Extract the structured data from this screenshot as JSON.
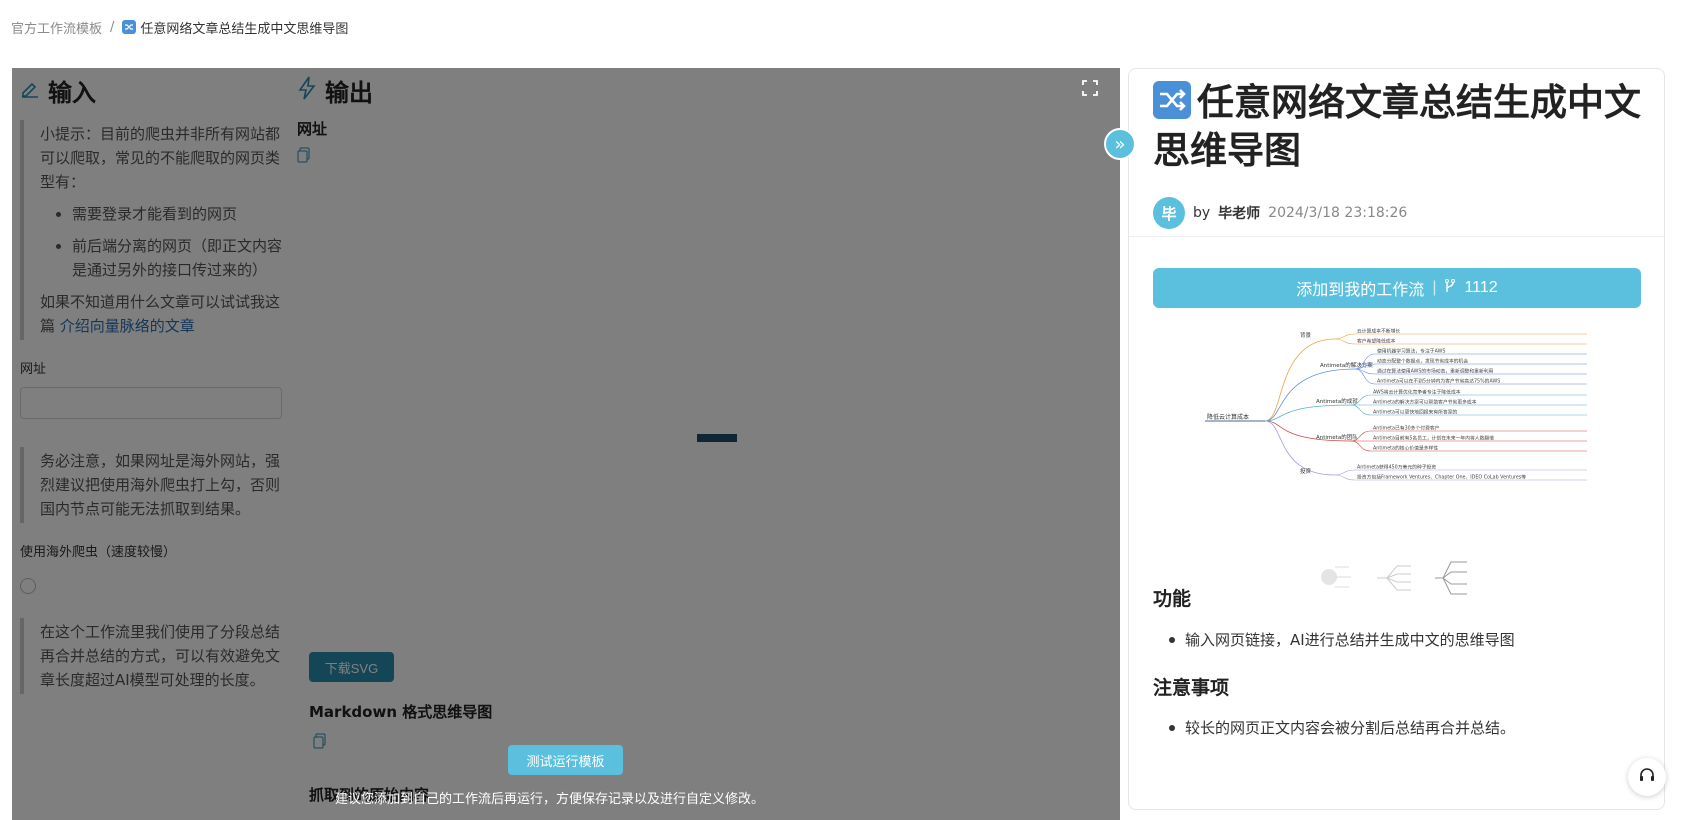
{
  "breadcrumb": {
    "parent": "官方工作流模板",
    "separator": "/",
    "current": "任意网络文章总结生成中文思维导图"
  },
  "input_section": {
    "title": "输入",
    "tip_intro": "小提示：目前的爬虫并非所有网站都可以爬取，常见的不能爬取的网页类型有：",
    "tip_items": [
      "需要登录才能看到的网页",
      "前后端分离的网页（即正文内容是通过另外的接口传过来的）"
    ],
    "tip_outro": "如果不知道用什么文章可以试试我这篇 ",
    "tip_link": "介绍向量脉络的文章",
    "url_label": "网址",
    "url_value": "",
    "warning": "务必注意，如果网址是海外网站，强烈建议把使用海外爬虫打上勾，否则国内节点可能无法抓取到结果。",
    "overseas_label": "使用海外爬虫（速度较慢）",
    "overseas_checked": false,
    "note": "在这个工作流里我们使用了分段总结再合并总结的方式，可以有效避免文章长度超过AI模型可处理的长度。"
  },
  "output_section": {
    "title": "输出",
    "url_label": "网址",
    "download_label": "下载SVG",
    "markdown_label": "Markdown 格式思维导图",
    "crawl_label": "抓取到的原始内容"
  },
  "actions": {
    "test_run": "测试运行模板",
    "hint": "建议您添加到自己的工作流后再运行，方便保存记录以及进行自定义修改。"
  },
  "panel": {
    "title": "任意网络文章总结生成中文思维导图",
    "avatar_char": "毕",
    "by": "by",
    "author": "毕老师",
    "date": "2024/3/18 23:18:26",
    "add_button": "添加到我的工作流",
    "fork_count": "1112",
    "feature_heading": "功能",
    "features": [
      "输入网页链接，AI进行总结并生成中文的思维导图"
    ],
    "notice_heading": "注意事项",
    "notices": [
      "较长的网页正文内容会被分割后总结再合并总结。"
    ]
  },
  "mindmap": {
    "root": "降低云计算成本",
    "branches": [
      {
        "label": "背景",
        "leaves": [
          "云计算成本不断增长",
          "客户希望降低成本"
        ]
      },
      {
        "label": "Antimeta的解决方案",
        "leaves": [
          "使用机器学习算法，专注于AWS",
          "动态分配整个数据点，发现节省成本的机会",
          "通过在算法使用AWS的市场动态，重新调整和重新利用",
          "Antimeta可以在不到5分钟内为客户节省高达75%的AWS"
        ]
      },
      {
        "label": "Antimeta的成就",
        "leaves": [
          "AWS将云计算优化竞争者专注于降低成本",
          "Antimeta的解决方案可以帮助客户节省更多成本",
          "Antimeta可以更快地回报来有所答案的"
        ]
      },
      {
        "label": "Antimeta的团队",
        "leaves": [
          "Antimeta已有30多个付费客户",
          "Antimeta目前有5名员工，计划在未来一年内将人数翻倍",
          "Antimeta的核心价值是多样性"
        ]
      },
      {
        "label": "投资",
        "leaves": [
          "Antimeta获得450万美元的种子投资",
          "投资方包括Framework Ventures、Chapter One、IDEO CoLab Ventures等"
        ]
      }
    ]
  },
  "colors": {
    "accent": "#5bc0de",
    "title_icon": "#4a90d9",
    "overlay": "rgba(0,0,0,0.5)"
  }
}
